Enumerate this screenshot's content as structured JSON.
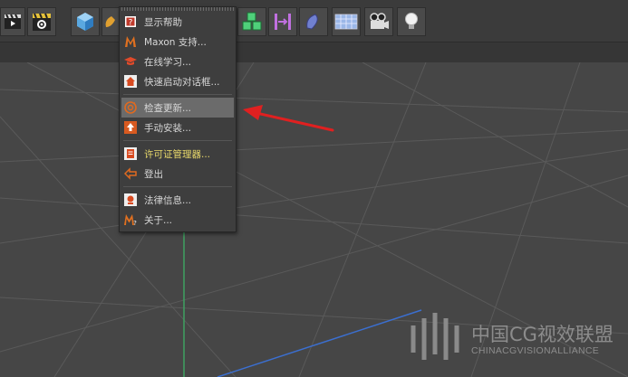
{
  "menu": {
    "items": [
      {
        "label": "显示帮助",
        "icon": "help-book-icon"
      },
      {
        "label": "Maxon 支持...",
        "icon": "maxon-logo-icon"
      },
      {
        "label": "在线学习...",
        "icon": "graduation-cap-icon"
      },
      {
        "label": "快速启动对话框...",
        "icon": "home-icon"
      },
      {
        "label": "检查更新...",
        "icon": "update-check-icon"
      },
      {
        "label": "手动安装...",
        "icon": "install-arrow-icon"
      },
      {
        "label": "许可证管理器...",
        "icon": "license-icon"
      },
      {
        "label": "登出",
        "icon": "logout-icon"
      },
      {
        "label": "法律信息...",
        "icon": "legal-info-icon"
      },
      {
        "label": "关于...",
        "icon": "about-icon"
      }
    ],
    "highlighted_index": 4
  },
  "watermark": {
    "title": "中国CG视效联盟",
    "subtitle": "CHINACGVISIONALLIANCE"
  },
  "colors": {
    "toolbar": "#3b3b3b",
    "viewport": "#464646",
    "menu_bg": "#3e3e3e",
    "highlight": "#6b6b6b",
    "license_text": "#e8d86a",
    "arrow": "#e02020",
    "axis_green": "#3fa060",
    "axis_blue": "#3b6fd0"
  }
}
